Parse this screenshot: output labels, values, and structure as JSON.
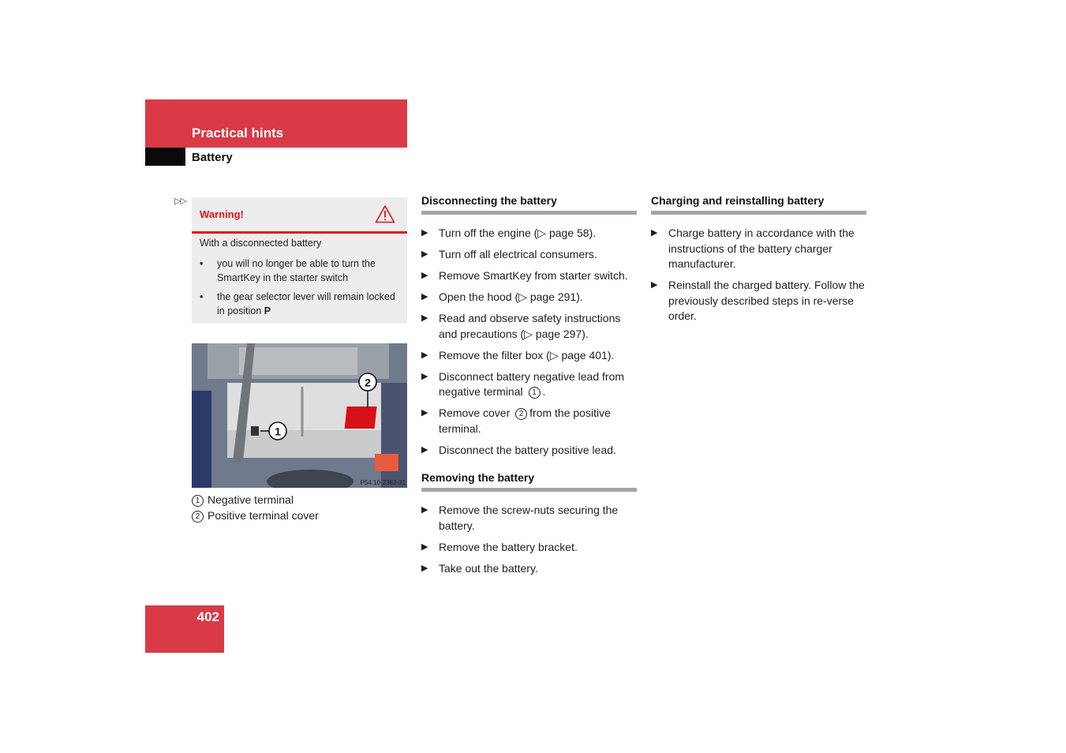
{
  "header": {
    "section": "Practical hints",
    "subsection": "Battery",
    "continuation_marker": "▷▷"
  },
  "warning": {
    "title": "Warning!",
    "icon": "warning-triangle-icon",
    "intro": "With a disconnected battery",
    "bullets": [
      {
        "text": "you will no longer be able to turn the SmartKey in the starter switch",
        "bold_suffix": ""
      },
      {
        "text": "the gear selector lever will remain locked in position ",
        "bold_suffix": "P"
      }
    ]
  },
  "figure": {
    "code": "P54.10-2382-31",
    "callouts": [
      "1",
      "2"
    ],
    "legend": [
      {
        "num": "1",
        "label": "Negative terminal"
      },
      {
        "num": "2",
        "label": "Positive terminal cover"
      }
    ]
  },
  "sections": [
    {
      "title": "Disconnecting the battery",
      "steps": [
        {
          "pre": "Turn off the engine (▷ page 58).",
          "num": "",
          "post": ""
        },
        {
          "pre": "Turn off all electrical consumers.",
          "num": "",
          "post": ""
        },
        {
          "pre": "Remove SmartKey from starter switch.",
          "num": "",
          "post": ""
        },
        {
          "pre": "Open the hood (▷ page 291).",
          "num": "",
          "post": ""
        },
        {
          "pre": "Read and observe safety instructions and precautions (▷ page 297).",
          "num": "",
          "post": ""
        },
        {
          "pre": "Remove the filter box (▷ page 401).",
          "num": "",
          "post": ""
        },
        {
          "pre": "Disconnect battery negative lead from negative terminal",
          "num": "1",
          "post": "."
        },
        {
          "pre": "Remove cover",
          "num": "2",
          "post": "from the positive terminal."
        },
        {
          "pre": "Disconnect the battery positive lead.",
          "num": "",
          "post": ""
        }
      ]
    },
    {
      "title": "Removing the battery",
      "steps": [
        {
          "pre": "Remove the screw-nuts securing the battery.",
          "num": "",
          "post": ""
        },
        {
          "pre": "Remove the battery bracket.",
          "num": "",
          "post": ""
        },
        {
          "pre": "Take out the battery.",
          "num": "",
          "post": ""
        }
      ]
    },
    {
      "title": "Charging and reinstalling battery",
      "steps": [
        {
          "pre": "Charge battery in accordance with the instructions of the battery charger manufacturer.",
          "num": "",
          "post": ""
        },
        {
          "pre": "Reinstall the charged battery. Follow the previously described steps in re-verse order.",
          "num": "",
          "post": ""
        }
      ]
    }
  ],
  "footer": {
    "page_number": "402"
  },
  "colors": {
    "brand_red": "#d93a46",
    "warning_red": "#e8101a",
    "rule_gray": "#a5a5a5",
    "warning_bg": "#ededed"
  },
  "glyphs": {
    "step_bullet": "▶",
    "warn_bullet": "•"
  }
}
